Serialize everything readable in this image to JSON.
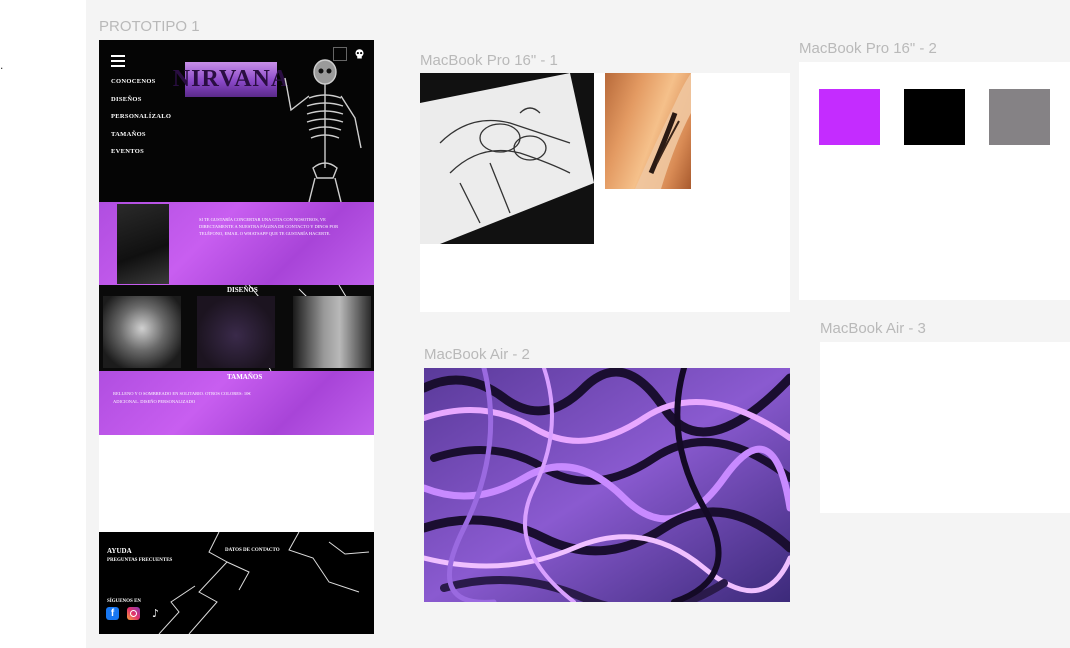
{
  "canvas": {
    "stray_mark": "."
  },
  "frames": {
    "prototype_label": "PROTOTIPO 1",
    "pro16_1_label": "MacBook Pro 16\" - 1",
    "pro16_2_label": "MacBook Pro 16\" - 2",
    "air2_label": "MacBook Air - 2",
    "air3_label": "MacBook Air - 3"
  },
  "prototype": {
    "nav": [
      "CONOCENOS",
      "DISEÑOS",
      "PERSONALÍZALO",
      "TAMAÑOS",
      "EVENTOS"
    ],
    "logo": "NIRVANA",
    "intro_text": "SI TE GUSTARÍA CONCERTAR UNA CITA CON NOSOTROS, VE DIRECTAMENTE A NUESTRA PÁGINA DE CONTACTO Y DINOS POR TELÉFONO, EMAIL O WHATSAPP QUE TE GUSTARÍA HACERTE.",
    "disenos_title": "DISEÑOS",
    "tamanos_title": "TAMAÑOS",
    "tamanos_text": "RELLENO Y O SOMBREADO EN SOLITARIO. OTROS COLORES: 10€ ADICIONAL. DISEÑO PERSONALIZADO",
    "footer": {
      "ayuda": "AYUDA",
      "faq": "PREGUNTAS FRECUENTES",
      "datos": "DATOS DE CONTACTO",
      "siguenos": "SÍGUENOS EN",
      "socials": [
        "facebook-icon",
        "instagram-icon",
        "tiktok-icon"
      ],
      "fb_glyph": "f",
      "tt_glyph": "♪"
    }
  },
  "palette": {
    "purple": "#c42cff",
    "black": "#000000",
    "gray": "#858285"
  }
}
